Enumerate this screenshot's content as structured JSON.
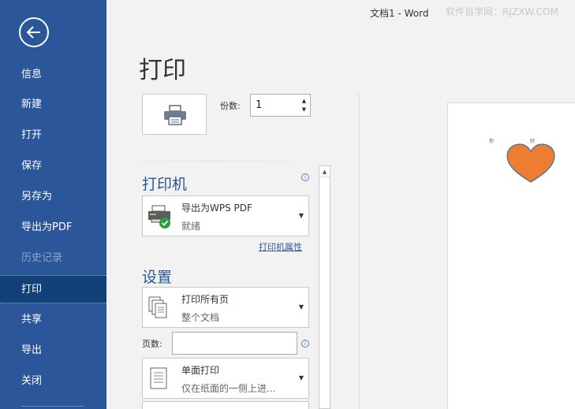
{
  "window": {
    "doc_title": "文档1  -  Word",
    "watermark": "软件自学网：RJZXW.COM"
  },
  "sidebar": {
    "items": [
      {
        "label": "信息"
      },
      {
        "label": "新建"
      },
      {
        "label": "打开"
      },
      {
        "label": "保存"
      },
      {
        "label": "另存为"
      },
      {
        "label": "导出为PDF"
      },
      {
        "label": "历史记录"
      },
      {
        "label": "打印"
      },
      {
        "label": "共享"
      },
      {
        "label": "导出"
      },
      {
        "label": "关闭"
      }
    ]
  },
  "main": {
    "heading": "打印",
    "copies_label": "份数:",
    "copies_value": "1",
    "printer_section": "打印机",
    "printer": {
      "name": "导出为WPS PDF",
      "status": "就绪"
    },
    "printer_props_link": "打印机属性",
    "settings_section": "设置",
    "setting_range": {
      "line1": "打印所有页",
      "line2": "整个文档"
    },
    "pages_label": "页数:",
    "setting_sides": {
      "line1": "单面打印",
      "line2": "仅在纸面的一侧上进..."
    }
  },
  "preview": {
    "text_left": "你",
    "text_right": "好",
    "heart_color": "#ed7d31"
  },
  "colors": {
    "sidebar": "#2b579a",
    "sidebar_active": "#124078",
    "accent": "#2b579a"
  }
}
